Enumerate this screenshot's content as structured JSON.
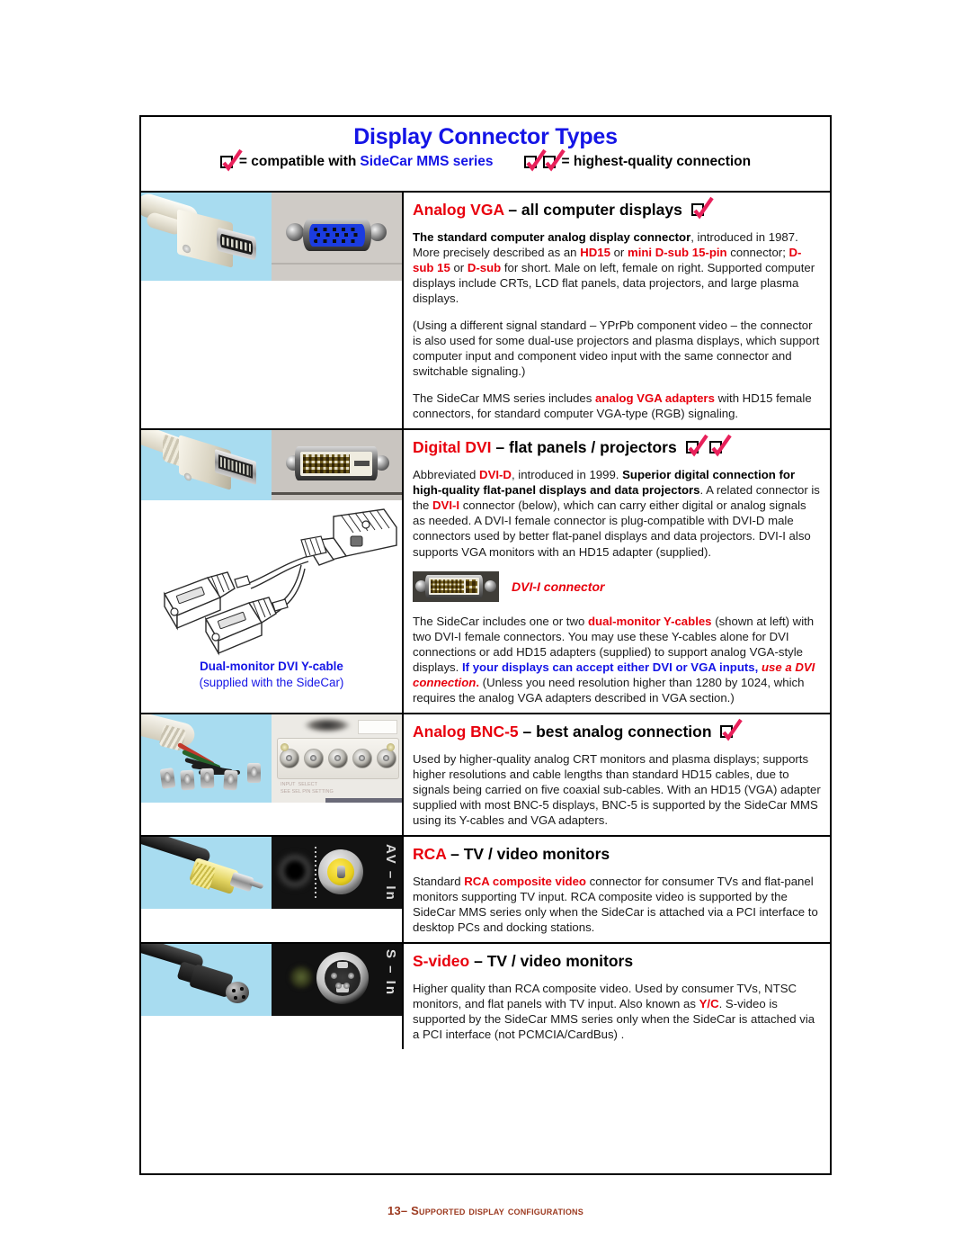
{
  "document": {
    "title": "Display Connector Types",
    "legend": {
      "left_text": "= compatible with ",
      "left_brand": "SideCar MMS series",
      "right_text": "= highest-quality connection"
    },
    "footer": "13– Supported display configurations"
  },
  "sections": [
    {
      "id": "vga",
      "heading_red": "Analog VGA",
      "heading_rest": "– all computer displays",
      "checks": 1,
      "paragraphs": [
        "The standard computer analog display connector, introduced in 1987. More precisely described as an HD15 or mini D-sub 15-pin connector; D-sub 15 or D-sub for short. Male on left, female on right. Supported computer displays include CRTs, LCD flat panels, data projectors, and large plasma displays.",
        "(Using a different signal standard – YPrPb component video – the connector is also used for some dual-use projectors and plasma displays, which support computer input and component video input with the same connector and switchable signaling.)",
        "The SideCar MMS series includes analog VGA adapters with HD15 female connectors, for standard computer VGA-type (RGB) signaling."
      ]
    },
    {
      "id": "dvi",
      "heading_red": "Digital DVI",
      "heading_rest": "– flat panels / projectors",
      "checks": 2,
      "paragraphs": [
        "Abbreviated DVI-D, introduced in 1999. Superior digital connection for high-quality flat-panel displays and data projectors. A related connector is the DVI-I connector (below), which can carry either digital or analog signals as needed. A DVI-I female connector is plug-compatible with DVI-D male connectors used by better flat-panel displays and data projectors. DVI-I also supports VGA monitors with an HD15 adapter (supplied).",
        "The SideCar includes one or two dual-monitor Y-cables (shown at left) with two DVI-I female connectors. You may use these Y-cables alone for DVI connections or add HD15 adapters (supplied) to support analog VGA-style displays. If your displays can accept either DVI or VGA inputs, use a DVI connection. (Unless you need resolution higher than 1280 by 1024, which requires the analog VGA adapters described in VGA section.)"
      ],
      "figure_label": "DVI-I connector",
      "caption_bold": "Dual-monitor DVI Y-cable",
      "caption_sub": "(supplied with the SideCar)"
    },
    {
      "id": "bnc",
      "heading_red": "Analog BNC-5",
      "heading_rest": "– best analog connection",
      "checks": 1,
      "paragraphs": [
        "Used by higher-quality analog CRT monitors and plasma displays; supports higher resolutions and cable lengths than standard HD15 cables, due to signals being carried on five coaxial sub-cables. With an HD15 (VGA) adapter supplied with most BNC-5 displays, BNC-5 is supported by the SideCar MMS using its Y-cables and VGA adapters."
      ]
    },
    {
      "id": "rca",
      "heading_red": "RCA",
      "heading_rest": "– TV / video monitors",
      "checks": 0,
      "paragraphs": [
        "Standard RCA composite video connector for consumer TVs and flat-panel monitors supporting TV input. RCA composite video is supported by the SideCar MMS series only when the SideCar is attached via a PCI interface to desktop PCs and docking stations."
      ],
      "port_label": "AV – In"
    },
    {
      "id": "svideo",
      "heading_red": "S-video",
      "heading_rest": "– TV / video monitors",
      "checks": 0,
      "paragraphs": [
        "Higher quality than RCA composite video. Used by consumer TVs, NTSC monitors, and flat panels with TV input. Also known as Y/C. S-video is supported  by the SideCar MMS series only when the SideCar is attached via a PCI interface (not PCMCIA/CardBus) ."
      ],
      "port_label": "S – In"
    }
  ],
  "colors": {
    "title_blue": "#1414e6",
    "accent_red": "#e8000d",
    "check_pink": "#e8215b",
    "footer_brown": "#9c3a20"
  }
}
